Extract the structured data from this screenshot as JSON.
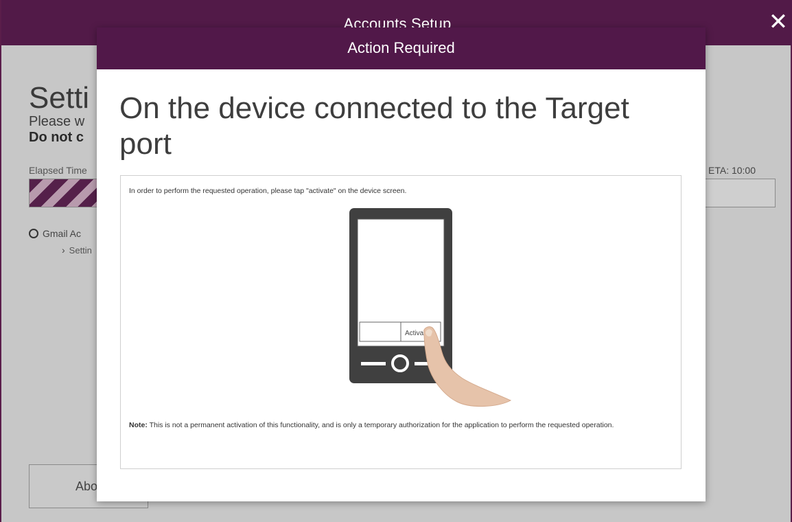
{
  "background_window": {
    "title": "Accounts Setup",
    "close_icon": "close-icon",
    "heading": "Setti",
    "subtitle": "Please w",
    "warning": "Do not c",
    "elapsed_label": "Elapsed Time",
    "eta_label": "ETA: 10:00",
    "progress_fraction": 0.11,
    "task_label": "Gmail Ac",
    "subtask_label": "Settin",
    "abort_button": "Abor"
  },
  "modal": {
    "title": "Action Required",
    "heading": "On the device connected to the Target port",
    "instruction": "In order to perform the requested operation, please tap \"activate\" on the device screen.",
    "illustration": {
      "button_label": "Activate",
      "icon": "phone-tap-illustration"
    },
    "note_label": "Note:",
    "note_text": "This is not a permanent activation of this functionality, and is only a temporary authorization for the application to perform the requested operation."
  },
  "colors": {
    "accent": "#511849",
    "background": "#c7c7c7",
    "modal_background": "#ffffff"
  }
}
